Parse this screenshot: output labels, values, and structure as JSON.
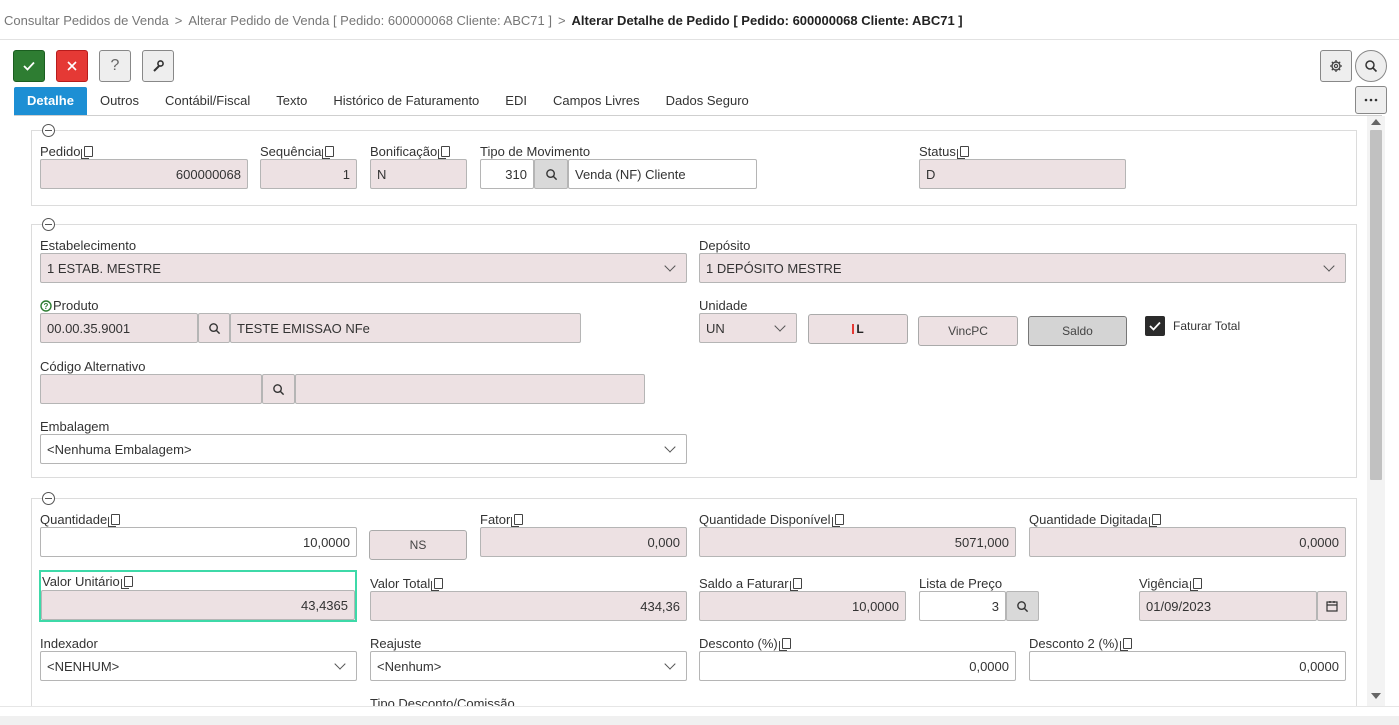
{
  "breadcrumb": {
    "item1": "Consultar Pedidos de Venda",
    "item2": "Alterar Pedido de Venda [ Pedido: 600000068 Cliente: ABC71 ]",
    "current": "Alterar Detalhe de Pedido [ Pedido: 600000068 Cliente: ABC71 ]",
    "separator": ">"
  },
  "toolbar": {
    "help": "?"
  },
  "tabs": [
    "Detalhe",
    "Outros",
    "Contábil/Fiscal",
    "Texto",
    "Histórico de Faturamento",
    "EDI",
    "Campos Livres",
    "Dados Seguro"
  ],
  "s1": {
    "pedido_label": "Pedido",
    "pedido": "600000068",
    "sequencia_label": "Sequência",
    "sequencia": "1",
    "bonificacao_label": "Bonificação",
    "bonificacao": "N",
    "tipo_mov_label": "Tipo de Movimento",
    "tipo_mov_code": "310",
    "tipo_mov_desc": "Venda (NF) Cliente",
    "status_label": "Status",
    "status": "D"
  },
  "s2": {
    "estab_label": "Estabelecimento",
    "estab": "1 ESTAB. MESTRE",
    "deposito_label": "Depósito",
    "deposito": "1 DEPÓSITO MESTRE",
    "produto_label": "Produto",
    "produto_code": "00.00.35.9001",
    "produto_desc": "TESTE EMISSAO  NFe",
    "unidade_label": "Unidade",
    "unidade": "UN",
    "btn_l": "L",
    "btn_vincpc": "VincPC",
    "btn_saldo": "Saldo",
    "faturar_total": "Faturar Total",
    "cod_alt_label": "Código Alternativo",
    "embalagem_label": "Embalagem",
    "embalagem": "<Nenhuma Embalagem>"
  },
  "s3": {
    "quantidade_label": "Quantidade",
    "quantidade": "10,0000",
    "ns": "NS",
    "fator_label": "Fator",
    "fator": "0,000",
    "qtd_disp_label": "Quantidade Disponível",
    "qtd_disp": "5071,000",
    "qtd_dig_label": "Quantidade Digitada",
    "qtd_dig": "0,0000",
    "valor_unit_label": "Valor Unitário",
    "valor_unit": "43,4365",
    "valor_total_label": "Valor Total",
    "valor_total": "434,36",
    "saldo_fat_label": "Saldo a Faturar",
    "saldo_fat": "10,0000",
    "lista_preco_label": "Lista de Preço",
    "lista_preco": "3",
    "vigencia_label": "Vigência",
    "vigencia": "01/09/2023",
    "indexador_label": "Indexador",
    "indexador": "<NENHUM>",
    "reajuste_label": "Reajuste",
    "reajuste": "<Nenhum>",
    "desconto_label": "Desconto (%)",
    "desconto": "0,0000",
    "desconto2_label": "Desconto 2 (%)",
    "desconto2": "0,0000",
    "tipo_desc_label": "Tipo Desconto/Comissão"
  }
}
